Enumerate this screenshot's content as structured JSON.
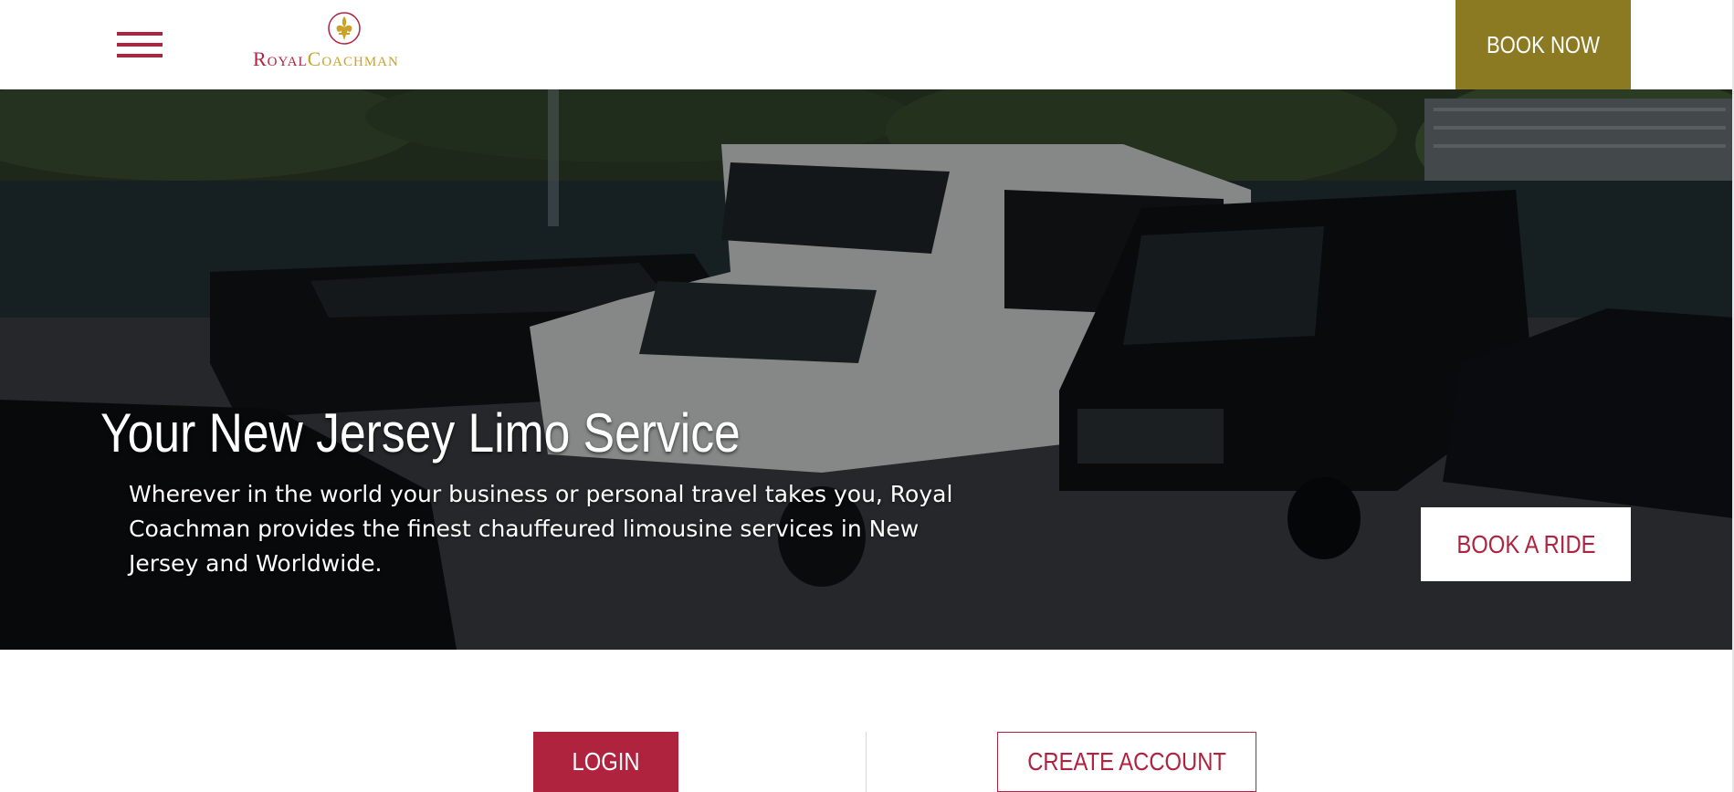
{
  "header": {
    "logo": {
      "royal": "Royal",
      "coach": "Coachman"
    },
    "book_now_label": "BOOK NOW"
  },
  "hero": {
    "title": "Your New Jersey Limo Service",
    "text": "Wherever in the world your business or personal travel takes you, Royal Coachman provides the finest chauffeured limousine services in New Jersey and Worldwide.",
    "book_ride_label": "BOOK A RIDE"
  },
  "auth": {
    "login_label": "LOGIN",
    "create_account_label": "CREATE ACCOUNT"
  },
  "colors": {
    "brand_red": "#b0233f",
    "brand_gold": "#8c7a22",
    "logo_gold": "#c9a227"
  },
  "icons": {
    "menu": "hamburger-menu-icon",
    "logo_emblem": "fleur-de-lis-icon"
  }
}
